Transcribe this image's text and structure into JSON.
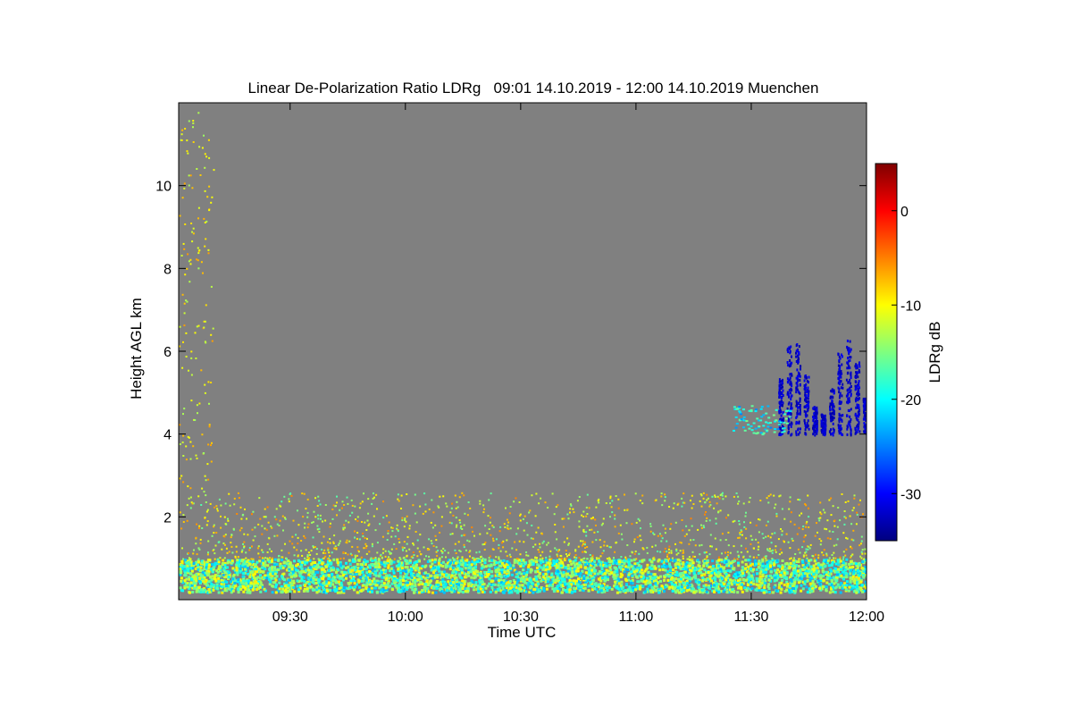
{
  "chart_data": {
    "type": "heatmap",
    "title": "Linear De-Polarization Ratio LDRg   09:01 14.10.2019 - 12:00 14.10.2019 Muenchen",
    "xlabel": "Time UTC",
    "ylabel": "Height AGL km",
    "x_ticks": [
      "09:30",
      "10:00",
      "10:30",
      "11:00",
      "11:30",
      "12:00"
    ],
    "x_tick_values_min": [
      570,
      600,
      630,
      660,
      690,
      720
    ],
    "xlim_min": [
      541,
      720
    ],
    "y_ticks": [
      "2",
      "4",
      "6",
      "8",
      "10"
    ],
    "y_tick_values": [
      2,
      4,
      6,
      8,
      10
    ],
    "ylim": [
      0,
      12
    ],
    "colorbar": {
      "label": "LDRg dB",
      "ticks": [
        "0",
        "-10",
        "-20",
        "-30"
      ],
      "tick_values": [
        0,
        -10,
        -20,
        -30
      ],
      "range": [
        -35,
        5
      ],
      "colormap": "jet"
    },
    "background_color": "#808080",
    "grid": false,
    "features": [
      {
        "name": "boundary layer",
        "time_min": [
          541,
          720
        ],
        "height_km": [
          0.2,
          1.0
        ],
        "ldr_db": -16
      },
      {
        "name": "scattered aerosol echoes",
        "time_min": [
          541,
          720
        ],
        "height_km": [
          1.0,
          2.6
        ],
        "ldr_db": -11
      },
      {
        "name": "ice cloud",
        "time_min": [
          685,
          720
        ],
        "height_km": [
          4.0,
          6.3
        ],
        "ldr_db": -32
      },
      {
        "name": "cloud base echo",
        "time_min": [
          685,
          700
        ],
        "height_km": [
          4.0,
          4.7
        ],
        "ldr_db": -20
      },
      {
        "name": "high speckles",
        "time_min": [
          541,
          550
        ],
        "height_km": [
          2.0,
          11.8
        ],
        "ldr_db": -10
      }
    ]
  }
}
